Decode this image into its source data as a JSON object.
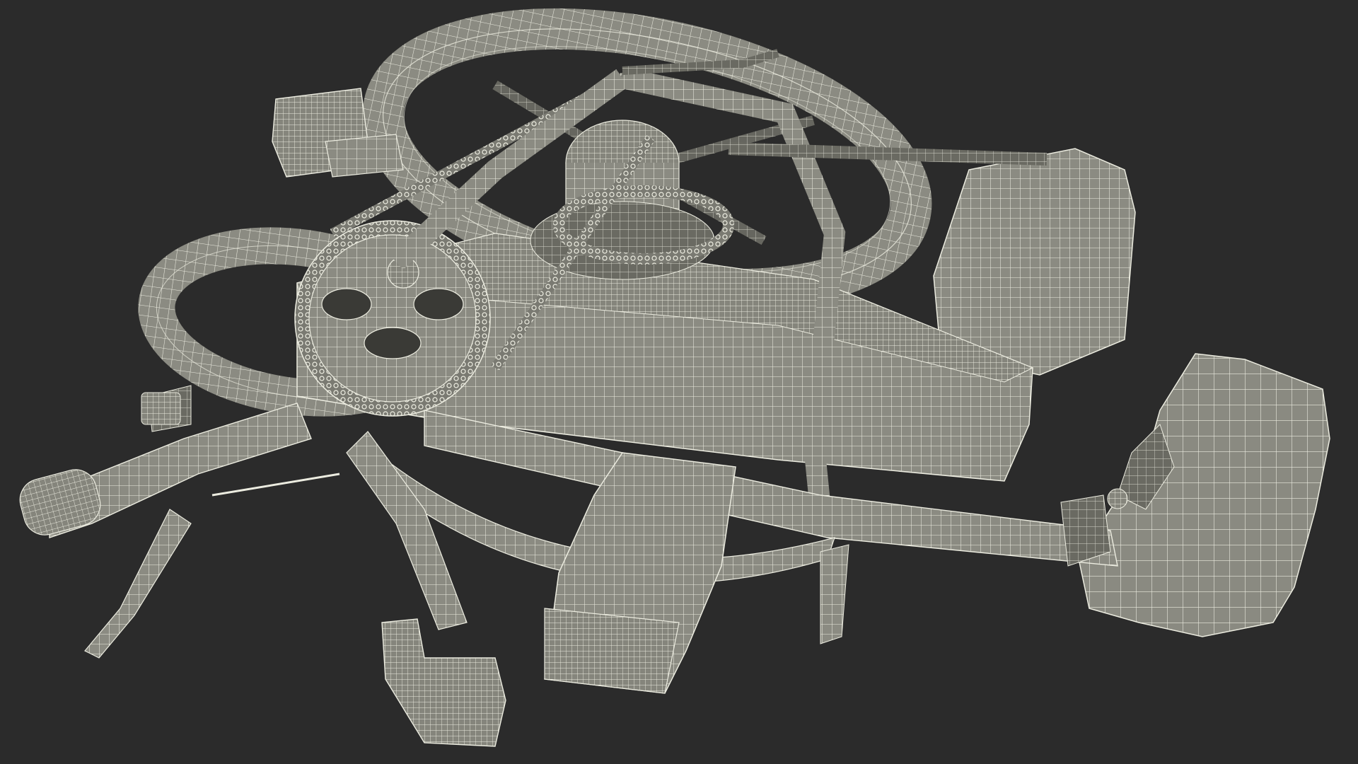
{
  "scene": {
    "subject": "folded-bicycle-wireframe",
    "background_color": "#2b2b2b",
    "surface_color": "#8e8e84",
    "surface_dark": "#5f5f58",
    "wire_color": "#e8e8dc"
  }
}
